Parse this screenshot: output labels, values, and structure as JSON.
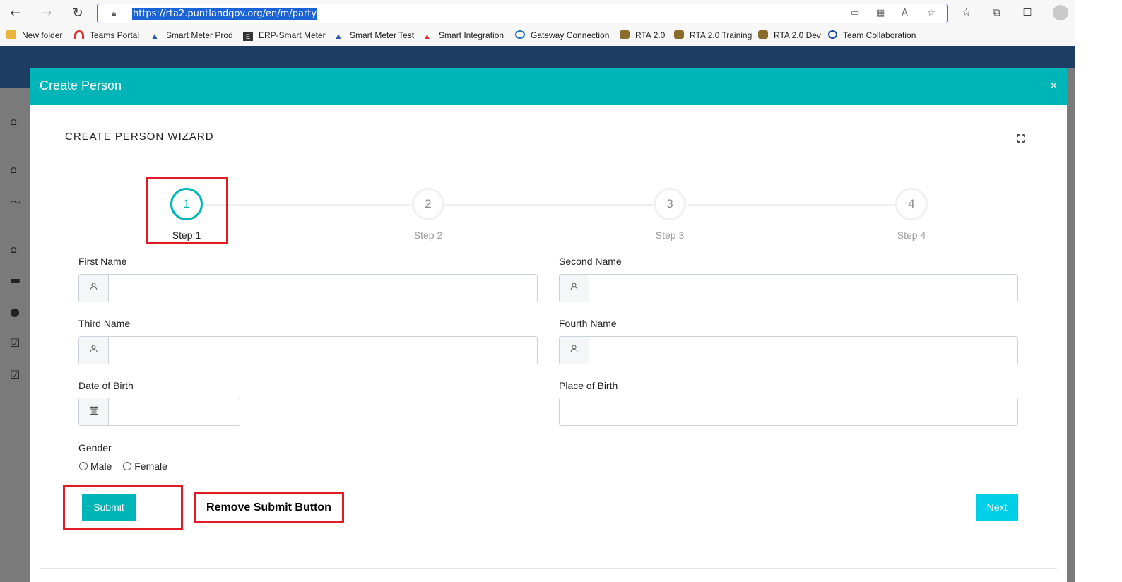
{
  "browser": {
    "url": "https://rta2.puntlandgov.org/en/m/party",
    "bookmarks": [
      "New folder",
      "Teams Portal",
      "Smart Meter Prod",
      "ERP-Smart Meter",
      "Smart Meter Test",
      "Smart Integration",
      "Gateway Connection",
      "RTA 2.0",
      "RTA 2.0 Training",
      "RTA 2.0 Dev",
      "Team Collaboration"
    ]
  },
  "modal": {
    "title": "Create Person",
    "close_glyph": "×",
    "wizard_title": "CREATE PERSON WIZARD"
  },
  "steps": [
    {
      "number": "1",
      "label": "Step 1",
      "active": true
    },
    {
      "number": "2",
      "label": "Step 2",
      "active": false
    },
    {
      "number": "3",
      "label": "Step 3",
      "active": false
    },
    {
      "number": "4",
      "label": "Step 4",
      "active": false
    }
  ],
  "form": {
    "first_name_label": "First Name",
    "second_name_label": "Second Name",
    "third_name_label": "Third Name",
    "fourth_name_label": "Fourth Name",
    "dob_label": "Date of Birth",
    "pob_label": "Place of Birth",
    "gender_label": "Gender",
    "gender_options": [
      "Male",
      "Female"
    ],
    "first_name_value": "",
    "second_name_value": "",
    "third_name_value": "",
    "fourth_name_value": "",
    "dob_value": "",
    "pob_value": ""
  },
  "buttons": {
    "submit": "Submit",
    "next": "Next"
  },
  "annotation": {
    "text": "Remove Submit Button",
    "color": "#e01b24"
  },
  "icons": {
    "user": "user-icon",
    "calendar": "calendar-icon",
    "expand": "expand-icon"
  },
  "colors": {
    "accent": "#00b5b8",
    "next_button": "#00cfe8",
    "header_bg": "#1d3d63"
  }
}
